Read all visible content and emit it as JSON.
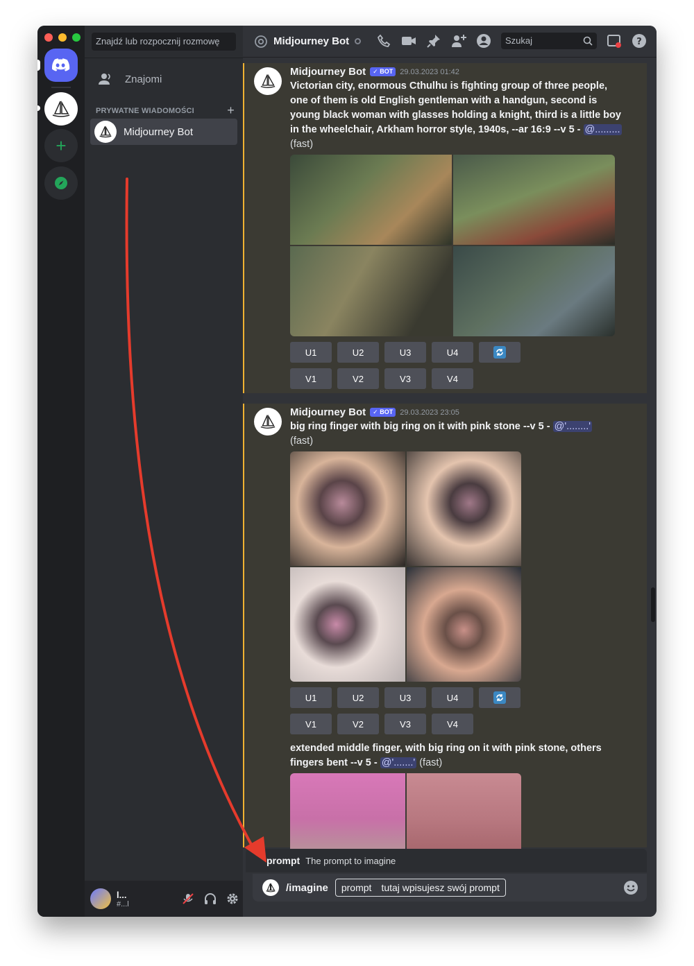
{
  "app": {
    "dm_search_placeholder": "Znajdź lub rozpocznij rozmowę",
    "friends_label": "Znajomi",
    "dm_header": "PRYWATNE WIADOMOŚCI",
    "dm_item": "Midjourney Bot",
    "user_name": "l...",
    "user_tag": "#...l"
  },
  "chat_header": {
    "channel_name": "Midjourney Bot",
    "search_placeholder": "Szukaj"
  },
  "messages": [
    {
      "author": "Midjourney Bot",
      "badge": "BOT",
      "timestamp": "29.03.2023 01:42",
      "text": "Victorian city, enormous Cthulhu is fighting group of three people, one of them is old English gentleman with a handgun, second is young black woman with glasses holding a knight, third is a little boy in the wheelchair, Arkham horror style, 1940s, --ar 16:9 --v 5 -",
      "mention": "@.........",
      "suffix": "(fast)",
      "buttons_u": [
        "U1",
        "U2",
        "U3",
        "U4"
      ],
      "buttons_v": [
        "V1",
        "V2",
        "V3",
        "V4"
      ]
    },
    {
      "author": "Midjourney Bot",
      "badge": "BOT",
      "timestamp": "29.03.2023 23:05",
      "text": "big ring finger with big ring on it with pink stone --v 5 -",
      "mention": "@'........'",
      "suffix": "(fast)",
      "buttons_u": [
        "U1",
        "U2",
        "U3",
        "U4"
      ],
      "buttons_v": [
        "V1",
        "V2",
        "V3",
        "V4"
      ],
      "followup_text": "extended middle finger, with big ring on it with pink stone, others fingers bent --v 5 -",
      "followup_mention": "@'.......'",
      "followup_suffix": "(fast)"
    }
  ],
  "composer": {
    "hint_label": "prompt",
    "hint_desc": "The prompt to imagine",
    "command": "/imagine",
    "arg_name": "prompt",
    "arg_value": "tutaj wpisujesz swój prompt"
  },
  "colors": {
    "accent": "#5865f2",
    "highlight_border": "#f0b232",
    "annotation_arrow": "#e53b2c"
  }
}
